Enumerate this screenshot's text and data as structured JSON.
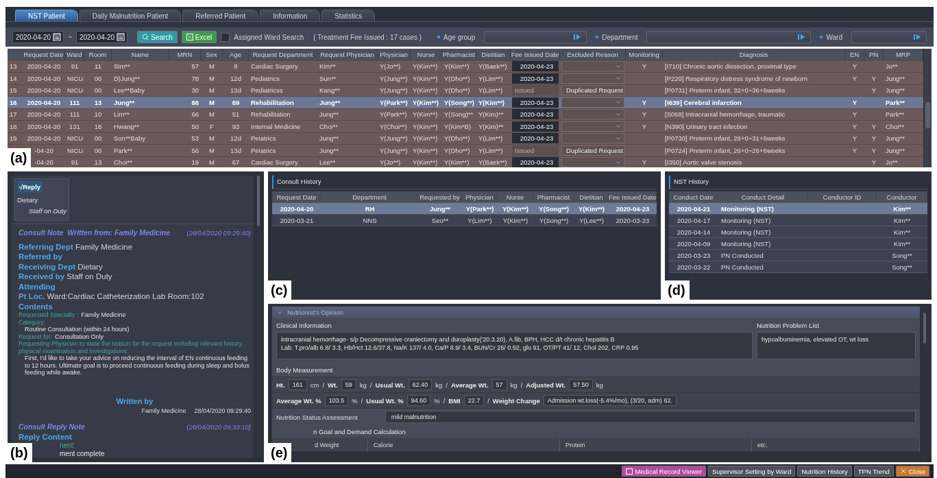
{
  "tabs": [
    {
      "label": "NST Patient",
      "selected": true
    },
    {
      "label": "Daily Malnutrition Patient",
      "selected": false
    },
    {
      "label": "Referred Patient",
      "selected": false
    },
    {
      "label": "Information",
      "selected": false
    },
    {
      "label": "Statistics",
      "selected": false
    }
  ],
  "filter": {
    "date_from": "2020-04-20",
    "date_separator": "~",
    "date_to": "2020-04-20",
    "search_button": "Search",
    "excel_button": "Excel",
    "assigned_ward": {
      "label": "Assigned Ward Search",
      "checked": false
    },
    "summary": "( Treatment Fee Issued : 17 cases )",
    "dropdowns": [
      {
        "label": "Age group"
      },
      {
        "label": "Department"
      },
      {
        "label": "Ward"
      }
    ]
  },
  "patients": {
    "label": "(a)",
    "columns": [
      "Request Date",
      "Ward",
      "Room",
      "Name",
      "MRN",
      "Sex",
      "Age",
      "Request Department",
      "Request Physician",
      "Physician",
      "Nurse",
      "Pharmacist",
      "Dietitian",
      "Fee Issued Date",
      "Excluded Reason",
      "Monitoring",
      "Diagnosis",
      "EN",
      "PN",
      "MRP"
    ],
    "rows": [
      {
        "no": "13",
        "request_date": "2020-04-20",
        "ward": "91",
        "room": "11",
        "name": "Sim**",
        "mrn": "57",
        "sex": "M",
        "age": "8",
        "department": "Cardiac Surgery",
        "request_physician": "Kim**",
        "physician": "Y(Jo**)",
        "nurse": "Y(Kim**)",
        "pharmacist": "Y(Kim**)",
        "dietitian": "Y(Baek**)",
        "fee": {
          "kind": "date",
          "text": "2020-04-23"
        },
        "monitoring": "Y",
        "diagnosis": "[I710] Chronic aortic dissection, proximal type",
        "en": "Y",
        "mrp": "Jo**",
        "selected": false
      },
      {
        "no": "14",
        "request_date": "2020-04-20",
        "ward": "NICU",
        "room": "00",
        "name": "D)Jung**",
        "mrn": "78",
        "sex": "M",
        "age": "12d",
        "department": "Pediatrics",
        "request_physician": "Sun**",
        "physician": "Y(Jung**)",
        "nurse": "Y(Kim**)",
        "pharmacist": "Y(Dho**)",
        "dietitian": "Y(Lim**)",
        "fee": {
          "kind": "date",
          "text": "2020-04-23"
        },
        "diagnosis": "[P220] Respiratory distress syndrome of newborn",
        "en": "Y",
        "pn": "Y",
        "mrp": "Jung**",
        "selected": false
      },
      {
        "no": "15",
        "request_date": "2020-04-20",
        "ward": "NICU",
        "room": "00",
        "name": "Lee**Baby",
        "mrn": "30",
        "sex": "M",
        "age": "13d",
        "department": "Pediatricss",
        "request_physician": "Kang**",
        "physician": "Y(Jung**)",
        "nurse": "Y(Kim**)",
        "pharmacist": "Y(Dho**)",
        "dietitian": "Y(Lim**)",
        "fee": {
          "kind": "issued",
          "text": "Issued"
        },
        "excluded_reason": "Duplicated Request",
        "diagnosis": "[P0731] Preterm infant, 32+0~36+6weeks",
        "pn": "Y",
        "mrp": "Jung**",
        "selected": false
      },
      {
        "no": "16",
        "request_date": "2020-04-20",
        "ward": "111",
        "room": "13",
        "name": "Jung**",
        "mrn": "86",
        "sex": "M",
        "age": "69",
        "department": "Rehabilitation",
        "request_physician": "Jung**",
        "physician": "Y(Park**)",
        "nurse": "Y(Kim**)",
        "pharmacist": "Y(Song**)",
        "dietitian": "Y(Kim**)",
        "fee": {
          "kind": "date",
          "text": "2020-04-23"
        },
        "monitoring": "Y",
        "diagnosis": "[I639] Cerebral infarction",
        "en": "Y",
        "mrp": "Park**",
        "selected": true
      },
      {
        "no": "17",
        "request_date": "2020-04-20",
        "ward": "111",
        "room": "10",
        "name": "Lim**",
        "mrn": "66",
        "sex": "M",
        "age": "51",
        "department": "Rehabilitation",
        "request_physician": "Jung**",
        "physician": "Y(Park**)",
        "nurse": "Y(Kim**)",
        "pharmacist": "Y(Song)**",
        "dietitian": "Y(Kim)**",
        "fee": {
          "kind": "date",
          "text": "2020-04-23"
        },
        "monitoring": "Y",
        "diagnosis": "[S068] Intracranial hemorrhage, traumatic",
        "en": "Y",
        "mrp": "Park**",
        "selected": false
      },
      {
        "no": "18",
        "request_date": "2020-04-20",
        "ward": "131",
        "room": "18",
        "name": "Hwang**",
        "mrn": "50",
        "sex": "F",
        "age": "93",
        "department": "Internal Medicine",
        "request_physician": "Choi**",
        "physician": "Y(Choi**)",
        "nurse": "Y(Kim**)",
        "pharmacist": "Y(Kim*B)",
        "dietitian": "Y(Kim)**",
        "fee": {
          "kind": "date",
          "text": "2020-04-23"
        },
        "monitoring": "Y",
        "diagnosis": "[N390] Urinary tract infection",
        "en": "Y",
        "pn": "Y",
        "mrp": "Choi**",
        "selected": false
      },
      {
        "no": "19",
        "request_date": "2020-04-20",
        "ward": "NICU",
        "room": "00",
        "name": "Son**Baby",
        "mrn": "53",
        "sex": "M",
        "age": "12d",
        "department": "Peiatrics",
        "request_physician": "Jung**",
        "physician": "Y(Jung**)",
        "nurse": "Y(Kim**)",
        "pharmacist": "Y(Dho**)",
        "dietitian": "Y(Lim**)",
        "fee": {
          "kind": "date",
          "text": "2020-04-23"
        },
        "diagnosis": "[P0730] Preterm infant, 28+0~31+6weeks",
        "en": "Y",
        "pn": "Y",
        "mrp": "Jung**",
        "selected": false
      },
      {
        "request_date": "-04-20",
        "ward": "NICU",
        "room": "00",
        "name": "Park**",
        "mrn": "56",
        "sex": "M",
        "age": "13d",
        "department": "Peiatrics",
        "request_physician": "Jung**",
        "physician": "Y(Jung**)",
        "nurse": "Y(Kim**)",
        "pharmacist": "Y(Dho**)",
        "dietitian": "Y(Lim**)",
        "fee": {
          "kind": "issued",
          "text": "Issued"
        },
        "excluded_reason": "Duplicated Request",
        "diagnosis": "[P0724] Preterm infant, 26+0~26+6weeks",
        "en": "Y",
        "pn": "Y",
        "mrp": "Jung**",
        "selected": false
      },
      {
        "request_date": "-04-20",
        "ward": "91",
        "room": "13",
        "name": "Choi**",
        "mrn": "19",
        "sex": "M",
        "age": "67",
        "department": "Cardiac Surgery",
        "request_physician": "Lee**",
        "physician": "Y(Jo**)",
        "nurse": "Y(Kim**)",
        "pharmacist": "Y(Kim**)",
        "dietitian": "Y(Baek**)",
        "fee": {
          "kind": "date",
          "text": "2020-04-23"
        },
        "monitoring": "Y",
        "diagnosis": "[I350] Aortic valve stenosis",
        "pn": "Y",
        "mrp": "Jo**",
        "selected": false
      }
    ]
  },
  "consult": {
    "label": "(b)",
    "reply_chip": {
      "label": "√Reply",
      "selected": true
    },
    "department": "Dietary",
    "staff": "Staff on Duty",
    "note": {
      "title": "Consult Note",
      "written_from": "Written from: Family Medicine",
      "time": "(28/04/2020 09:29:40)",
      "fields": [
        {
          "label": "Referring Dept",
          "value": "Family Medicine"
        },
        {
          "label": "Referred by"
        },
        {
          "label": "Receiving Dept",
          "value": "Dietary"
        },
        {
          "label": "Received by",
          "value": "Staff on Duty"
        },
        {
          "label": "Attending"
        },
        {
          "label": "Pt Loc.",
          "value": "Ward:Cardiac Catheterization Lab Room:102"
        }
      ],
      "contents_heading": "Contents",
      "contents": [
        {
          "kind": "key",
          "text": "Requested Specialty :",
          "value": "Family Medicine"
        },
        {
          "kind": "key",
          "text": "Category:"
        },
        {
          "kind": "indent",
          "text": "Routine Consultation (within 24 hours)"
        },
        {
          "kind": "key",
          "text": "Request for:",
          "value": "Consultation Only"
        },
        {
          "kind": "key",
          "text": "Requesting Physician to state the reason for the request including relevant history, physical examination and investigations:"
        },
        {
          "kind": "indent",
          "text": "First, I'd like to take your advice on reducing the interval of EN continuous feeding to 12 hours. Ultimate goal is to proceed continuous feeding during sleep and bolus feeding while awake."
        }
      ],
      "written_by": "Written by",
      "signature": [
        "Family Medicine",
        "28/04/2020 09:29:40"
      ]
    },
    "reply": {
      "title": "Consult Reply Note",
      "time": "(28/04/2020 09:33:10)",
      "heading": "Reply Content",
      "lines": [
        {
          "kind": "key",
          "text": "nent:"
        },
        {
          "kind": "indent",
          "text": "ment complete"
        }
      ]
    }
  },
  "consult_history": {
    "label": "(c)",
    "title": "Consult History",
    "columns": [
      "Request Date",
      "Department",
      "Requested by",
      "Physician",
      "Nurse",
      "Pharmacist",
      "Dietitian",
      "Fee Issued Date"
    ],
    "rows": [
      {
        "cells": [
          "2020-04-20",
          "RH",
          "Jung**",
          "Y(Park**)",
          "Y(Kim**)",
          "Y(Song**)",
          "Y(Kim**)",
          "2020-04-23"
        ],
        "selected": true
      },
      {
        "cells": [
          "2020-03-21",
          "NNS",
          "Seo**",
          "Y(Lim**)",
          "Y(Kim**)",
          "Y(Song**)",
          "Y(Lee**)",
          "2020-03-23"
        ],
        "selected": false
      }
    ]
  },
  "nst_history": {
    "label": "(d)",
    "title": "NST History",
    "columns": [
      "Conduct Date",
      "Conduct Detail",
      "Conductor ID",
      "Conductor"
    ],
    "rows": [
      {
        "date": "2020-04-21",
        "detail": "Monitoring (NST)",
        "conductor": "Kim**",
        "selected": true
      },
      {
        "date": "2020-04-17",
        "detail": "Monitoring (NST)",
        "conductor": "Kim**",
        "selected": false
      },
      {
        "date": "2020-04-14",
        "detail": "Monitoring (NST)",
        "conductor": "Kim**",
        "selected": false
      },
      {
        "date": "2020-04-09",
        "detail": "Monitoring (NST)",
        "conductor": "Kim**",
        "selected": false
      },
      {
        "date": "2020-03-23",
        "detail": "PN Conducted",
        "conductor": "Song**",
        "selected": false
      },
      {
        "date": "2020-03-22",
        "detail": "PN Conducted",
        "conductor": "Song**",
        "selected": false
      }
    ]
  },
  "opinion": {
    "label": "(e)",
    "title": "Nutrionist's Opinion",
    "expanded": true,
    "clinical": {
      "heading": "Clinical Information",
      "lines": [
        "intracranial hemorrhage- s/p Decompressive craniectomy and duroplasty('20.3.20), A.fib, BPH, HCC d/t chronic hepatitis B",
        "Lab. T.pro/alb  6.8/ 3.3,  Hb/Hct 12.6/37.8,  Na/K  137/ 4.0,  Ca/P  8.9/ 3.4,  BUN/Cr  26/ 0.92,  glu  91,  OT/PT 41/ 12,  Chol 202,  CRP 0.95"
      ]
    },
    "problems": {
      "heading": "Nutrition Problem List",
      "text": "hypoalbuminemia, elevated OT, wt loss"
    },
    "body": {
      "heading": "Body Measurement",
      "lines": [
        {
          "measures": [
            {
              "label": "Ht.",
              "value": "161",
              "unit": "cm",
              "sep": "/"
            },
            {
              "label": "Wt.",
              "value": "59",
              "unit": "kg",
              "sep": "/"
            },
            {
              "label": "Usual Wt.",
              "value": "62.40",
              "unit": "kg",
              "sep": "/"
            },
            {
              "label": "Average Wt.",
              "value": "57",
              "unit": "kg",
              "sep": "/"
            },
            {
              "label": "Adjusted Wt.",
              "value": "57.50",
              "unit": "kg"
            }
          ]
        },
        {
          "measures": [
            {
              "label": "Average Wt. %",
              "value": "103.5",
              "unit": "%",
              "sep": "/"
            },
            {
              "label": "Usual Wt. %",
              "value": "94.60",
              "unit": "%",
              "sep": "/"
            },
            {
              "label": "BMI",
              "value": "22.7",
              "sep": "/"
            },
            {
              "label": "Weight Change",
              "value": "Admission  wt.loss(-5.4%/mo), (3/20, adm) 62."
            }
          ]
        }
      ]
    },
    "assessment": {
      "label": "Nutrition Status Assessment",
      "value": "mild malnutrition"
    },
    "goal": {
      "heading": "n Goal and Demand Calculation",
      "columns": [
        "d Weight",
        "Calorie",
        "Protein",
        "etc."
      ]
    }
  },
  "footer": [
    {
      "label": "Medical Record Viewer",
      "kind": "viewer"
    },
    {
      "label": "Supervisor Setting by Ward",
      "kind": "plain"
    },
    {
      "label": "Nutrition History",
      "kind": "plain"
    },
    {
      "label": "TPN Trend",
      "kind": "plain"
    },
    {
      "label": "Close",
      "kind": "close"
    }
  ]
}
